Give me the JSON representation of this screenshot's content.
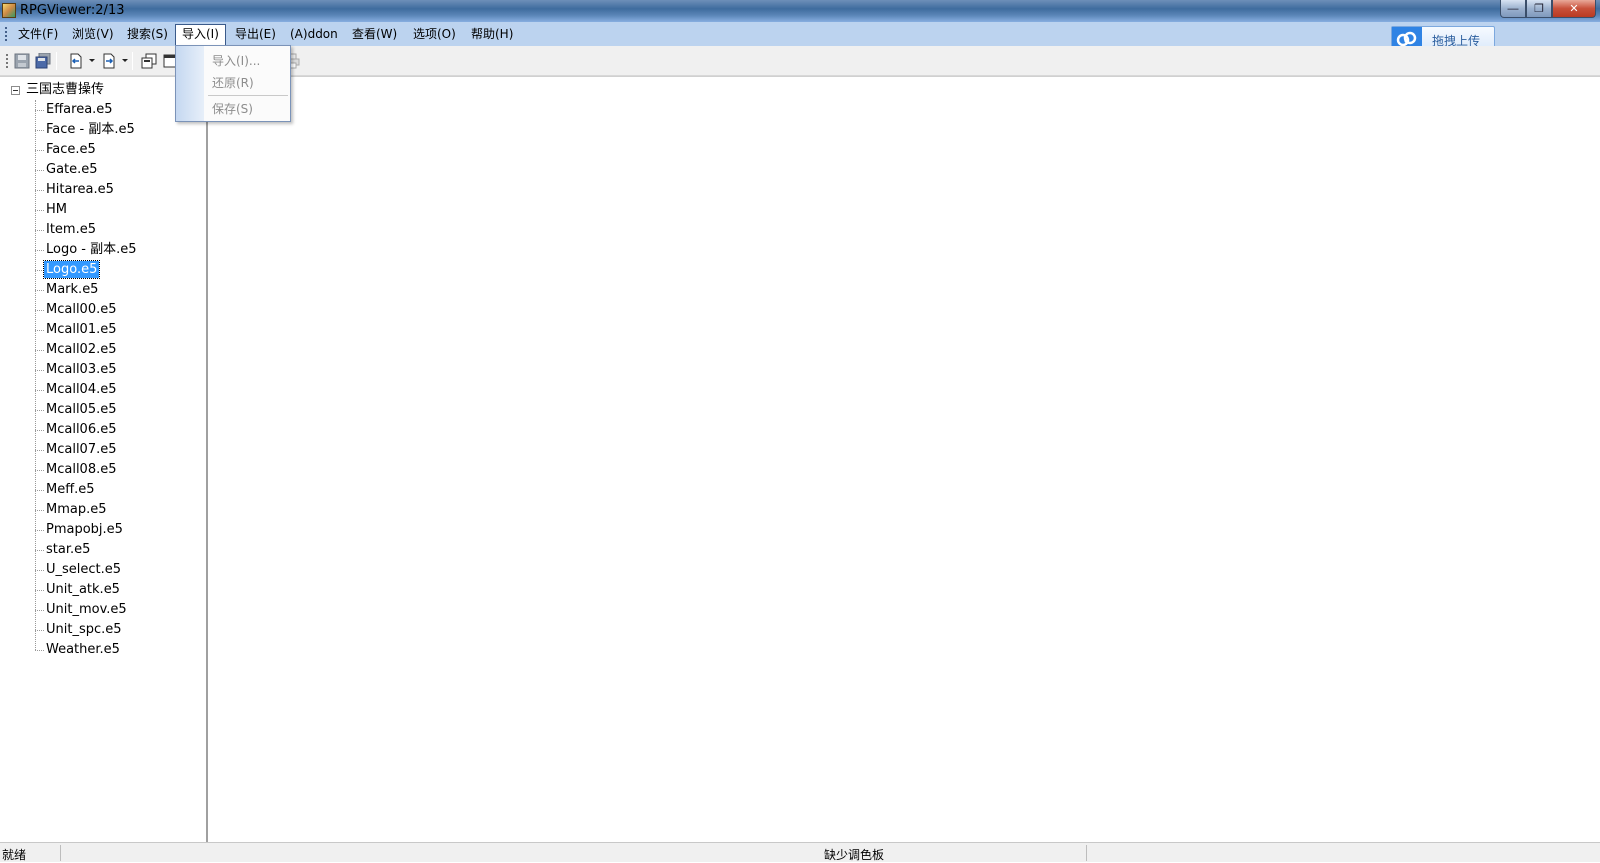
{
  "window": {
    "title": "RPGViewer:2/13"
  },
  "menubar": {
    "items": [
      {
        "label": "文件(F)"
      },
      {
        "label": "浏览(V)"
      },
      {
        "label": "搜索(S)"
      },
      {
        "label": "导入(I)",
        "active": true
      },
      {
        "label": "导出(E)"
      },
      {
        "label": "(A)ddon"
      },
      {
        "label": "查看(W)"
      },
      {
        "label": "选项(O)"
      },
      {
        "label": "帮助(H)"
      }
    ],
    "upload_button": "拖拽上传"
  },
  "import_menu": {
    "items": [
      {
        "label": "导入(I)...",
        "enabled": false
      },
      {
        "label": "还原(R)",
        "enabled": false
      },
      {
        "label": "保存(S)",
        "enabled": false
      }
    ]
  },
  "toolbar": {
    "icons": [
      "save-icon",
      "save-all-icon",
      "import-icon",
      "export-icon",
      "copy-icon",
      "window-icon",
      "print-icon"
    ]
  },
  "tree": {
    "root": "三国志曹操传",
    "items": [
      "Effarea.e5",
      "Face - 副本.e5",
      "Face.e5",
      "Gate.e5",
      "Hitarea.e5",
      "HM",
      "Item.e5",
      "Logo - 副本.e5",
      "Logo.e5",
      "Mark.e5",
      "Mcall00.e5",
      "Mcall01.e5",
      "Mcall02.e5",
      "Mcall03.e5",
      "Mcall04.e5",
      "Mcall05.e5",
      "Mcall06.e5",
      "Mcall07.e5",
      "Mcall08.e5",
      "Meff.e5",
      "Mmap.e5",
      "Pmapobj.e5",
      "star.e5",
      "U_select.e5",
      "Unit_atk.e5",
      "Unit_mov.e5",
      "Unit_spc.e5",
      "Weather.e5"
    ],
    "selected": "Logo.e5"
  },
  "statusbar": {
    "left": "就绪",
    "middle": "缺少调色板"
  },
  "colors": {
    "menubar_bg": "#bcd3ef",
    "selection": "#3399ff",
    "upload_accent": "#2f83e4"
  }
}
